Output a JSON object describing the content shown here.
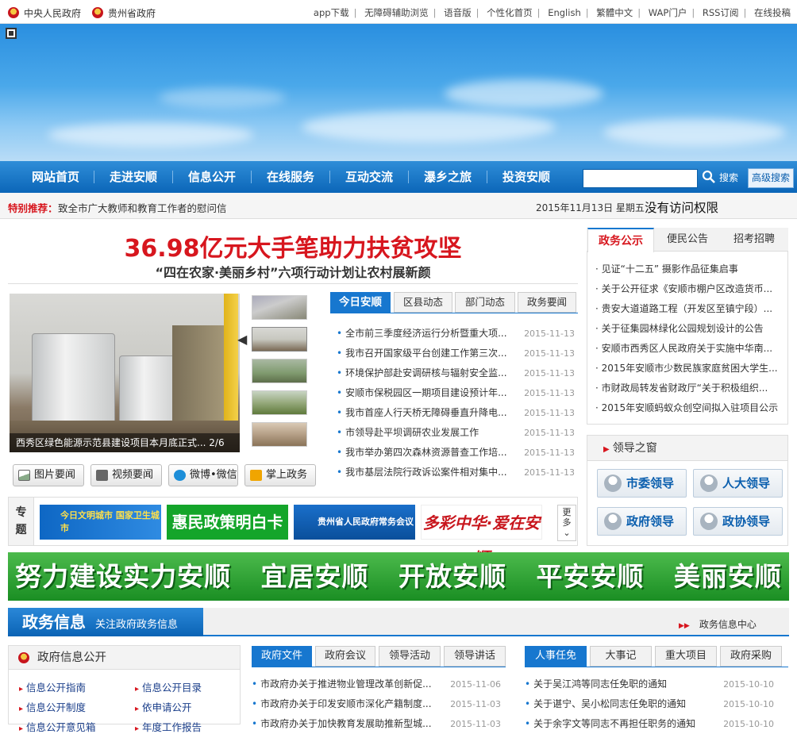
{
  "topbar": {
    "gov_central": "中央人民政府",
    "gov_province": "贵州省政府",
    "links": [
      "app下载",
      "无障碍辅助浏览",
      "语音版",
      "个性化首页",
      "English",
      "繁體中文",
      "WAP门户",
      "RSS订阅",
      "在线投稿"
    ]
  },
  "nav": {
    "items": [
      "网站首页",
      "走进安顺",
      "信息公开",
      "在线服务",
      "互动交流",
      "瀑乡之旅",
      "投资安顺"
    ],
    "search_button": "搜索",
    "advanced_search": "高级搜索",
    "search_value": ""
  },
  "recommend": {
    "label": "特别推荐：",
    "text": "致全市广大教师和教育工作者的慰问信",
    "date": "2015年11月13日  星期五",
    "notice": "没有访问权限"
  },
  "headline": {
    "title": "36.98亿元大手笔助力扶贫攻坚",
    "subtitle": "“四在农家·美丽乡村”六项行动计划让农村展新颜"
  },
  "photo": {
    "caption": "西秀区绿色能源示范县建设项目本月底正式...",
    "counter": "2/6"
  },
  "quick_buttons": [
    "图片要闻",
    "视频要闻",
    "微博•微信",
    "掌上政务"
  ],
  "news_tabs": [
    "今日安顺",
    "区县动态",
    "部门动态",
    "政务要闻"
  ],
  "news": [
    {
      "title": "全市前三季度经济运行分析暨重大项...",
      "date": "2015-11-13"
    },
    {
      "title": "我市召开国家级平台创建工作第三次...",
      "date": "2015-11-13"
    },
    {
      "title": "环境保护部赴安调研核与辐射安全监...",
      "date": "2015-11-13"
    },
    {
      "title": "安顺市保税园区一期项目建设预计年...",
      "date": "2015-11-13"
    },
    {
      "title": "我市首座人行天桥无障碍垂直升降电...",
      "date": "2015-11-13"
    },
    {
      "title": "市领导赴平坝调研农业发展工作",
      "date": "2015-11-13"
    },
    {
      "title": "我市举办第四次森林资源普查工作培...",
      "date": "2015-11-13"
    },
    {
      "title": "我市基层法院行政诉讼案件相对集中...",
      "date": "2015-11-13"
    }
  ],
  "topics": {
    "label": "专题",
    "banners": [
      "今日文明城市 国家卫生城市",
      "惠民政策明白卡",
      "贵州省人民政府常务会议",
      "多彩中华·爱在安顺"
    ],
    "more": "更多"
  },
  "right_tabs": [
    "政务公示",
    "便民公告",
    "招考招聘"
  ],
  "right_news": [
    "见证“十二五” 摄影作品征集启事",
    "关于公开征求《安顺市棚户区改造货币...",
    "贵安大道道路工程（开发区至镇宁段）...",
    "关于征集园林绿化公园规划设计的公告",
    "安顺市西秀区人民政府关于实施中华南...",
    "2015年安顺市少数民族家庭贫困大学生...",
    "市财政局转发省财政厅“关于积极组织...",
    "2015年安顺蚂蚁众创空间拟入驻项目公示"
  ],
  "leaders": {
    "title": "领导之窗",
    "buttons": [
      "市委领导",
      "人大领导",
      "政府领导",
      "政协领导"
    ]
  },
  "slogan": "努力建设实力安顺   宜居安顺   开放安顺   平安安顺   美丽安顺",
  "section": {
    "title": "政务信息",
    "subtitle": "关注政府政务信息",
    "center": "政务信息中心"
  },
  "info_open": {
    "title": "政府信息公开",
    "links": [
      "信息公开指南",
      "信息公开目录",
      "信息公开制度",
      "依申请公开",
      "信息公开意见箱",
      "年度工作报告"
    ]
  },
  "doc_tabs": [
    "政府文件",
    "政府会议",
    "领导活动",
    "领导讲话"
  ],
  "docs": [
    {
      "title": "市政府办关于推进物业管理改革创新促...",
      "date": "2015-11-06"
    },
    {
      "title": "市政府办关于印发安顺市深化产籍制度...",
      "date": "2015-11-03"
    },
    {
      "title": "市政府办关于加快教育发展助推新型城...",
      "date": "2015-11-03"
    }
  ],
  "hr_tabs": [
    "人事任免",
    "大事记",
    "重大项目",
    "政府采购"
  ],
  "hr": [
    {
      "title": "关于吴江鸿等同志任免职的通知",
      "date": "2015-10-10"
    },
    {
      "title": "关于谌宁、吴小松同志任免职的通知",
      "date": "2015-10-10"
    },
    {
      "title": "关于余字文等同志不再担任职务的通知",
      "date": "2015-10-10"
    }
  ],
  "colors": {
    "brand_blue": "#1777cf",
    "red": "#d7161e",
    "green": "#1a8e23"
  }
}
